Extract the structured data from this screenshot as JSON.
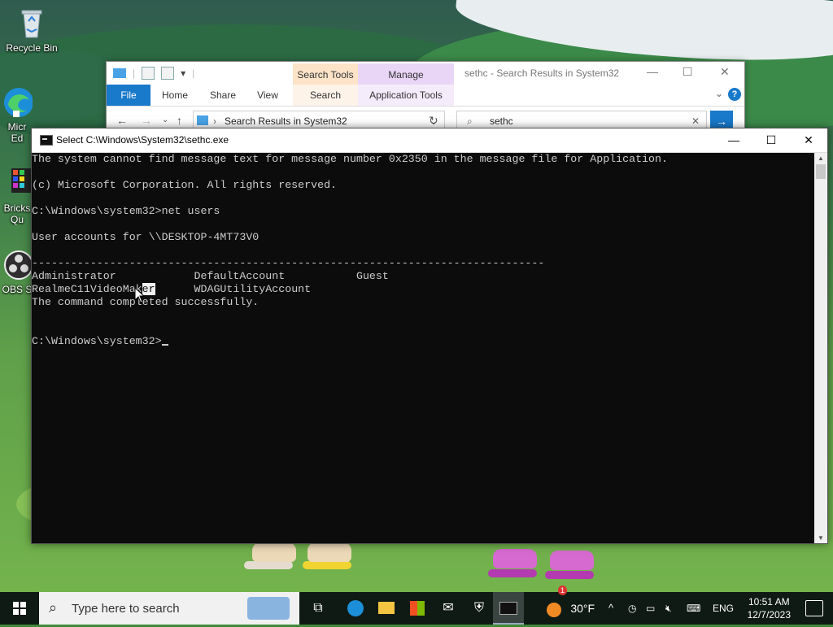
{
  "desktop": {
    "icons": [
      {
        "label": "Recycle Bin"
      },
      {
        "label": "Micr Ed"
      },
      {
        "label": "Bricks Qu"
      },
      {
        "label": "OBS S"
      }
    ]
  },
  "explorer": {
    "title": "sethc - Search Results in System32",
    "context_search": "Search Tools",
    "context_manage": "Manage",
    "tabs": [
      "File",
      "Home",
      "Share",
      "View",
      "Search",
      "Application Tools"
    ],
    "address": "Search Results in System32",
    "search_value": "sethc",
    "help": "?"
  },
  "console": {
    "title": "Select C:\\Windows\\System32\\sethc.exe",
    "lines": [
      "The system cannot find message text for message number 0x2350 in the message file for Application.",
      "",
      "(c) Microsoft Corporation. All rights reserved.",
      "",
      "C:\\Windows\\system32>net users",
      "",
      "User accounts for \\\\DESKTOP-4MT73V0",
      "",
      "-------------------------------------------------------------------------------",
      "Administrator            DefaultAccount           Guest",
      "RealmeC11VideoMak",
      "The command completed successfully.",
      "",
      "",
      "C:\\Windows\\system32>"
    ],
    "selected_text": "er",
    "after_selection": "      WDAGUtilityAccount"
  },
  "taskbar": {
    "search_placeholder": "Type here to search",
    "weather": "30°F",
    "weather_badge": "1",
    "language": "ENG",
    "time": "10:51 AM",
    "date": "12/7/2023"
  }
}
